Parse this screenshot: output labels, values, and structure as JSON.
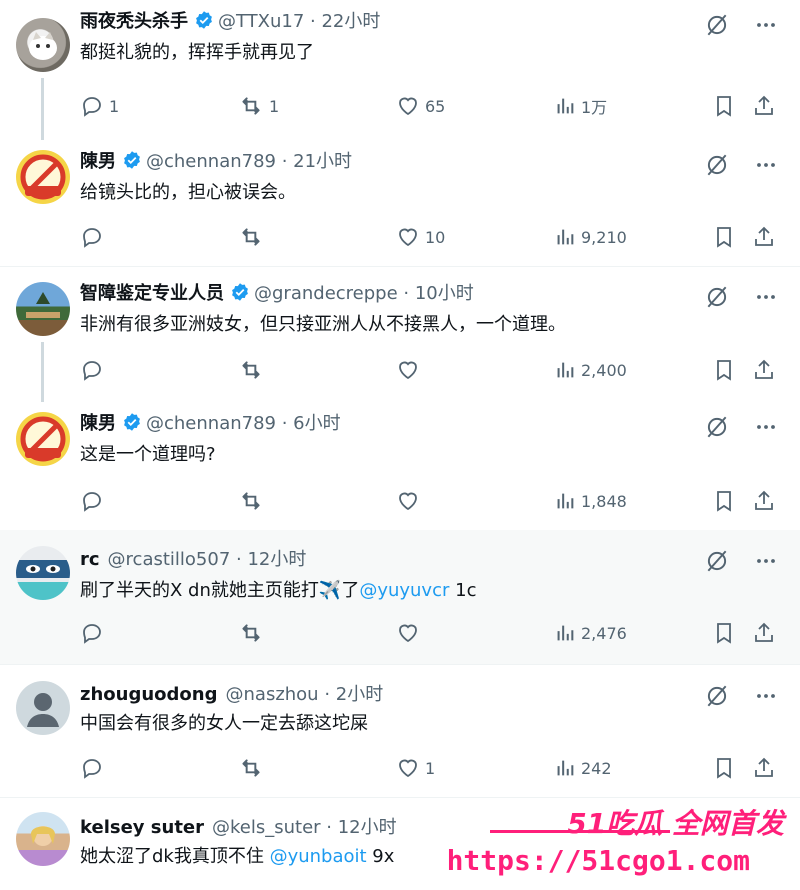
{
  "tweets": [
    {
      "name": "雨夜秃头杀手",
      "handle": "@TTXu17 · 22小时",
      "text": "都挺礼貌的，挥挥手就再见了",
      "reply": "1",
      "retweet": "1",
      "like": "65",
      "views": "1万",
      "verified": true
    },
    {
      "name": "陳男",
      "handle": "@chennan789 · 21小时",
      "text": "给镜头比的，担心被误会。",
      "reply": "",
      "retweet": "",
      "like": "10",
      "views": "9,210",
      "verified": true
    },
    {
      "name": "智障鉴定专业人员",
      "handle": "@grandecreppe · 10小时",
      "text": "非洲有很多亚洲妓女，但只接亚洲人从不接黑人，一个道理。",
      "reply": "",
      "retweet": "",
      "like": "",
      "views": "2,400",
      "verified": true
    },
    {
      "name": "陳男",
      "handle": "@chennan789 · 6小时",
      "text": "这是一个道理吗?",
      "reply": "",
      "retweet": "",
      "like": "",
      "views": "1,848",
      "verified": true
    },
    {
      "name": "rc",
      "handle": "@rcastillo507 · 12小时",
      "text_pre": "刷了半天的X dn就她主页能打",
      "text_emoji": "✈️",
      "text_mid": "了",
      "mention": "@yuyuvcr",
      "text_post": " 1c",
      "reply": "",
      "retweet": "",
      "like": "",
      "views": "2,476",
      "verified": false
    },
    {
      "name": "zhouguodong",
      "handle": "@naszhou · 2小时",
      "text": "中国会有很多的女人一定去舔这坨屎",
      "reply": "",
      "retweet": "",
      "like": "1",
      "views": "242",
      "verified": false
    },
    {
      "name": "kelsey suter",
      "handle": "@kels_suter · 12小时",
      "text_pre": "她太涩了dk我真顶不住 ",
      "mention": "@yunbaoit",
      "text_post": " 9x",
      "verified": false
    }
  ],
  "watermark": {
    "top": "51吃瓜 全网首发",
    "url": "https://51cgo1.com"
  },
  "colors": {
    "accent": "#1d9bf0",
    "muted": "#536471",
    "watermark": "#ff1f7a"
  }
}
